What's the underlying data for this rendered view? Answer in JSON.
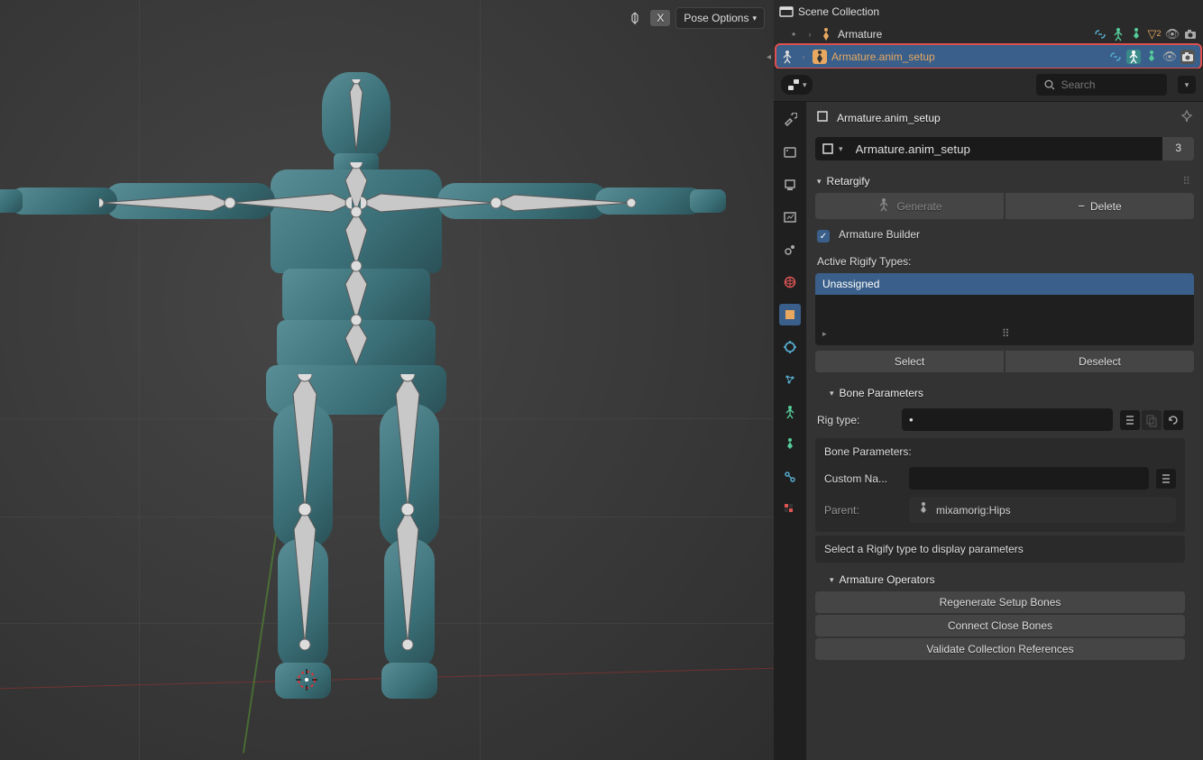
{
  "viewport": {
    "mirror_badge": "X",
    "pose_options": "Pose Options"
  },
  "outliner": {
    "scene_collection": "Scene Collection",
    "items": [
      {
        "label": "Armature",
        "count": "2"
      },
      {
        "label": "Armature.anim_setup"
      }
    ]
  },
  "search": {
    "placeholder": "Search"
  },
  "breadcrumb": {
    "name": "Armature.anim_setup"
  },
  "name_field": {
    "value": "Armature.anim_setup",
    "users": "3"
  },
  "retargify": {
    "title": "Retargify",
    "generate": "Generate",
    "delete": "Delete",
    "armature_builder": "Armature Builder",
    "active_rigify_label": "Active Rigify Types:",
    "list_item": "Unassigned",
    "select": "Select",
    "deselect": "Deselect"
  },
  "bone_params": {
    "title": "Bone Parameters",
    "rig_type_label": "Rig type:",
    "params_label": "Bone Parameters:",
    "custom_name_label": "Custom Na...",
    "custom_name_value": "",
    "parent_label": "Parent:",
    "parent_value": "mixamorig:Hips",
    "hint": "Select a Rigify type to display parameters"
  },
  "armature_ops": {
    "title": "Armature Operators",
    "regenerate": "Regenerate Setup Bones",
    "connect": "Connect Close Bones",
    "validate": "Validate Collection References"
  }
}
